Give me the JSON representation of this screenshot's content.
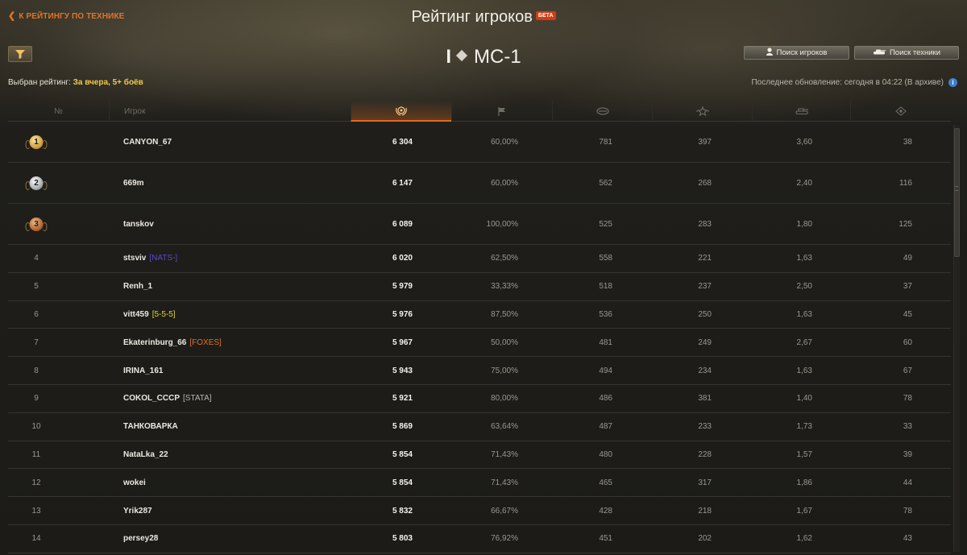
{
  "header": {
    "back_label": "К РЕЙТИНГУ ПО ТЕХНИКЕ",
    "title": "Рейтинг игроков",
    "beta_badge": "БЕТА",
    "vehicle_tier": "I",
    "vehicle_name": "МС-1",
    "search_players_label": "Поиск игроков",
    "search_vehicles_label": "Поиск техники",
    "rating_label": "Выбран рейтинг: ",
    "rating_value": "За вчера, 5+ боёв",
    "last_update": "Последнее обновление: сегодня в 04:22 (В архиве)"
  },
  "columns": {
    "rank": "№",
    "player": "Игрок",
    "score_icon": "rating-laurel-icon",
    "wins_icon": "flag-icon",
    "damage_icon": "damage-icon",
    "star_icon": "star-icon",
    "frags_icon": "tank-frags-icon",
    "spot_icon": "spotting-icon"
  },
  "accent_color": "#e36a22",
  "rows": [
    {
      "rank": "1",
      "medal": "gold",
      "name": "CANYON_67",
      "clan": "",
      "clan_color": "",
      "score": "6 304",
      "win": "60,00%",
      "c3": "781",
      "c4": "397",
      "c5": "3,60",
      "c6": "38"
    },
    {
      "rank": "2",
      "medal": "silver",
      "name": "669m",
      "clan": "",
      "clan_color": "",
      "score": "6 147",
      "win": "60,00%",
      "c3": "562",
      "c4": "268",
      "c5": "2,40",
      "c6": "116"
    },
    {
      "rank": "3",
      "medal": "bronze",
      "name": "tanskov",
      "clan": "",
      "clan_color": "",
      "score": "6 089",
      "win": "100,00%",
      "c3": "525",
      "c4": "283",
      "c5": "1,80",
      "c6": "125"
    },
    {
      "rank": "4",
      "medal": "",
      "name": "stsviv",
      "clan": "[NATS-]",
      "clan_color": "#5a49c9",
      "score": "6 020",
      "win": "62,50%",
      "c3": "558",
      "c4": "221",
      "c5": "1,63",
      "c6": "49"
    },
    {
      "rank": "5",
      "medal": "",
      "name": "Renh_1",
      "clan": "",
      "clan_color": "",
      "score": "5 979",
      "win": "33,33%",
      "c3": "518",
      "c4": "237",
      "c5": "2,50",
      "c6": "37"
    },
    {
      "rank": "6",
      "medal": "",
      "name": "vitt459",
      "clan": "[5-5-5]",
      "clan_color": "#e3d23a",
      "score": "5 976",
      "win": "87,50%",
      "c3": "536",
      "c4": "250",
      "c5": "1,63",
      "c6": "45"
    },
    {
      "rank": "7",
      "medal": "",
      "name": "Ekaterinburg_66",
      "clan": "[FOXES]",
      "clan_color": "#d9742a",
      "score": "5 967",
      "win": "50,00%",
      "c3": "481",
      "c4": "249",
      "c5": "2,67",
      "c6": "60"
    },
    {
      "rank": "8",
      "medal": "",
      "name": "IRINA_161",
      "clan": "",
      "clan_color": "",
      "score": "5 943",
      "win": "75,00%",
      "c3": "494",
      "c4": "234",
      "c5": "1,63",
      "c6": "67"
    },
    {
      "rank": "9",
      "medal": "",
      "name": "COKOL_CCCP",
      "clan": "[STATA]",
      "clan_color": "#b8b5ad",
      "score": "5 921",
      "win": "80,00%",
      "c3": "486",
      "c4": "381",
      "c5": "1,40",
      "c6": "78"
    },
    {
      "rank": "10",
      "medal": "",
      "name": "ТАНКОВАРКА",
      "clan": "",
      "clan_color": "",
      "score": "5 869",
      "win": "63,64%",
      "c3": "487",
      "c4": "233",
      "c5": "1,73",
      "c6": "33"
    },
    {
      "rank": "11",
      "medal": "",
      "name": "NataLka_22",
      "clan": "",
      "clan_color": "",
      "score": "5 854",
      "win": "71,43%",
      "c3": "480",
      "c4": "228",
      "c5": "1,57",
      "c6": "39"
    },
    {
      "rank": "12",
      "medal": "",
      "name": "wokei",
      "clan": "",
      "clan_color": "",
      "score": "5 854",
      "win": "71,43%",
      "c3": "465",
      "c4": "317",
      "c5": "1,86",
      "c6": "44"
    },
    {
      "rank": "13",
      "medal": "",
      "name": "Yrik287",
      "clan": "",
      "clan_color": "",
      "score": "5 832",
      "win": "66,67%",
      "c3": "428",
      "c4": "218",
      "c5": "1,67",
      "c6": "78"
    },
    {
      "rank": "14",
      "medal": "",
      "name": "persey28",
      "clan": "",
      "clan_color": "",
      "score": "5 803",
      "win": "76,92%",
      "c3": "451",
      "c4": "202",
      "c5": "1,62",
      "c6": "43"
    }
  ]
}
